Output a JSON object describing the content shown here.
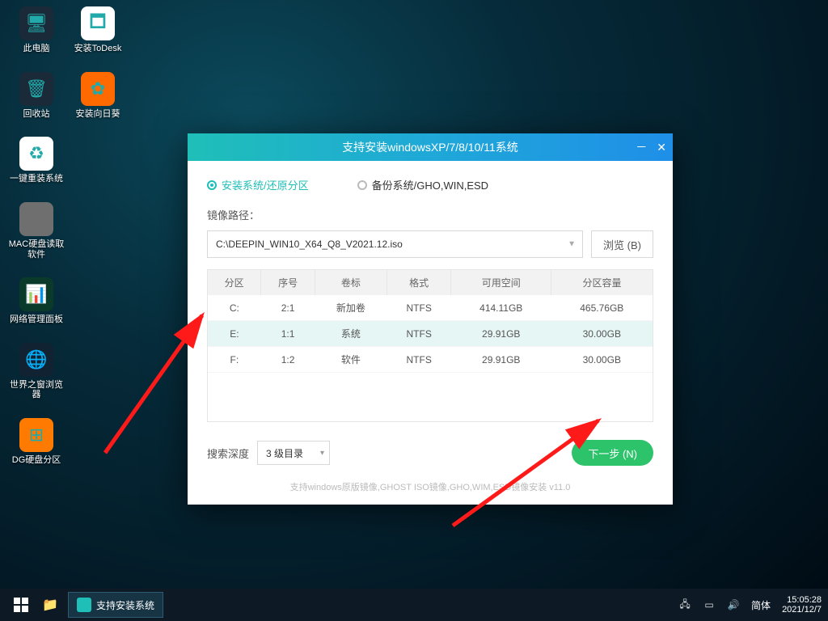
{
  "desktop_icons_col1": [
    {
      "name": "pc",
      "label": "此电脑",
      "bg": "#1b2a38",
      "glyph": "🖥"
    },
    {
      "name": "recycle",
      "label": "回收站",
      "bg": "#1b2a38",
      "glyph": "🗑"
    },
    {
      "name": "reinstall",
      "label": "一键重装系统",
      "bg": "#ffffff",
      "glyph": "♻"
    },
    {
      "name": "mac",
      "label": "MAC硬盘读取软件",
      "bg": "#6f6f6f",
      "glyph": ""
    },
    {
      "name": "net",
      "label": "网络管理面板",
      "bg": "#0a3a2a",
      "glyph": "📊"
    },
    {
      "name": "browser",
      "label": "世界之窗浏览器",
      "bg": "#123",
      "glyph": "🌐"
    },
    {
      "name": "dg",
      "label": "DG硬盘分区",
      "bg": "#ff7a00",
      "glyph": "⊞"
    }
  ],
  "desktop_icons_col2": [
    {
      "name": "todesk",
      "label": "安装ToDesk",
      "bg": "#ffffff",
      "glyph": "🗖"
    },
    {
      "name": "sunflower",
      "label": "安装向日葵",
      "bg": "#ff6a00",
      "glyph": "✿"
    }
  ],
  "dialog": {
    "title": "支持安装windowsXP/7/8/10/11系统",
    "radio_install": "安装系统/还原分区",
    "radio_backup": "备份系统/GHO,WIN,ESD",
    "path_label": "镜像路径：",
    "path_value": "C:\\DEEPIN_WIN10_X64_Q8_V2021.12.iso",
    "browse": "浏览 (B)",
    "columns": [
      "分区",
      "序号",
      "卷标",
      "格式",
      "可用空间",
      "分区容量"
    ],
    "rows": [
      {
        "drive": "C:",
        "seq": "2:1",
        "vol": "新加卷",
        "fs": "NTFS",
        "free": "414.11GB",
        "total": "465.76GB"
      },
      {
        "drive": "E:",
        "seq": "1:1",
        "vol": "系统",
        "fs": "NTFS",
        "free": "29.91GB",
        "total": "30.00GB"
      },
      {
        "drive": "F:",
        "seq": "1:2",
        "vol": "软件",
        "fs": "NTFS",
        "free": "29.91GB",
        "total": "30.00GB"
      }
    ],
    "depth_label": "搜索深度",
    "depth_value": "3 级目录",
    "next": "下一步 (N)",
    "footer": "支持windows原版镜像,GHOST ISO镜像,GHO,WIM,ESD镜像安装 v11.0"
  },
  "taskbar": {
    "app": "支持安装系统",
    "ime": "简体",
    "time": "15:05:28",
    "date": "2021/12/7"
  }
}
